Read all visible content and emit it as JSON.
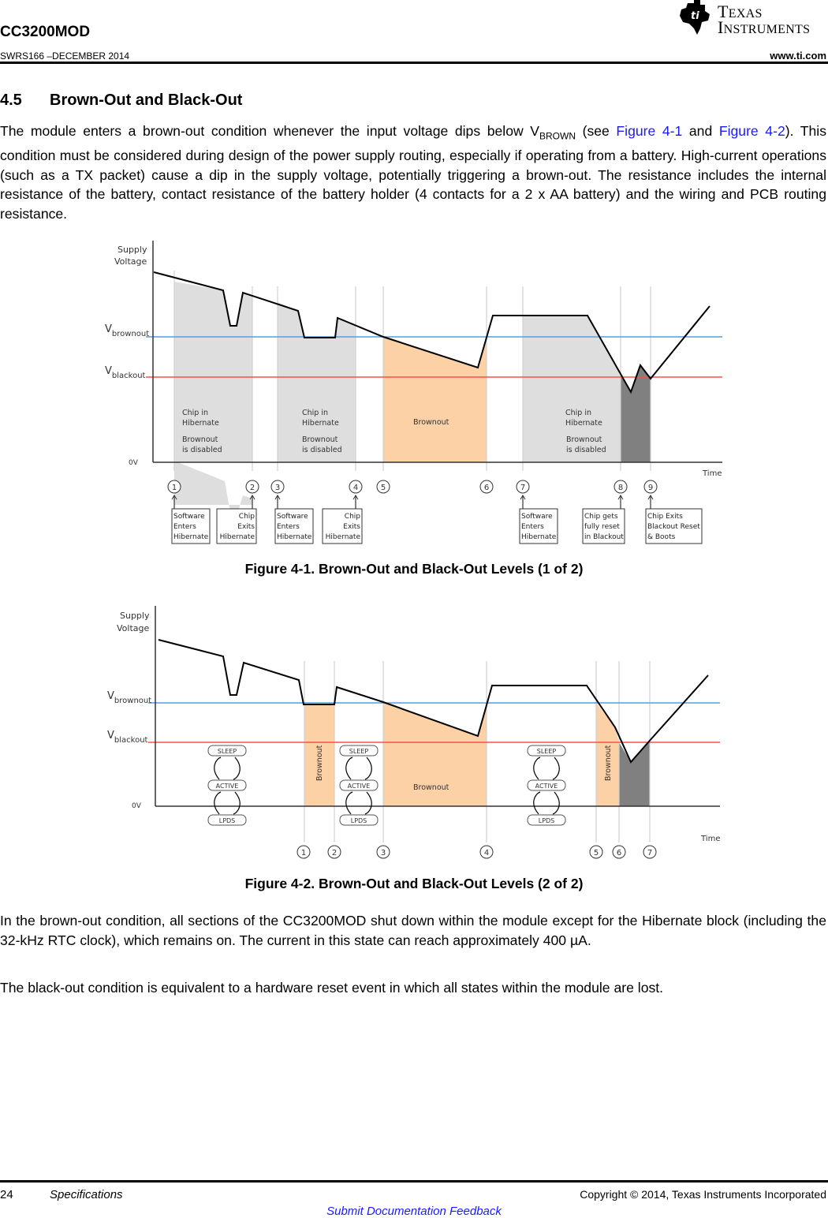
{
  "header": {
    "doc_title": "CC3200MOD",
    "doc_id": "SWRS166 –DECEMBER 2014",
    "url": "www.ti.com",
    "logo_line1": "Texas",
    "logo_line2": "Instruments"
  },
  "section": {
    "number": "4.5",
    "title": "Brown-Out and Black-Out"
  },
  "paragraph1": {
    "t1": "The module enters a brown-out condition whenever the input voltage dips below V",
    "sub": "BROWN",
    "t2": " (see ",
    "link1": "Figure 4-1",
    "t3": " and ",
    "link2": "Figure 4-2",
    "t4": "). This condition must be considered during design of the power supply routing, especially if operating from a battery. High-current operations (such as a TX packet) cause a dip in the supply voltage, potentially triggering a brown-out. The resistance includes the internal resistance of the battery, contact resistance of the battery holder (4 contacts for a 2 x AA battery) and the wiring and PCB routing resistance."
  },
  "figure1": {
    "caption": "Figure 4-1. Brown-Out and Black-Out Levels (1 of 2)",
    "y_label_1": "Supply",
    "y_label_2": "Voltage",
    "v_brownout_main": "V",
    "v_brownout_sub": "brownout",
    "v_blackout_main": "V",
    "v_blackout_sub": "blackout",
    "zero_label": "0V",
    "x_label": "Time",
    "regions": [
      {
        "line1": "Chip in",
        "line2": "Hibernate",
        "line3": "Brownout",
        "line4": "is disabled"
      },
      {
        "line1": "Chip in",
        "line2": "Hibernate",
        "line3": "Brownout",
        "line4": "is disabled"
      },
      {
        "line1": "Brownout"
      },
      {
        "line1": "Chip in",
        "line2": "Hibernate",
        "line3": "Brownout",
        "line4": "is disabled"
      }
    ],
    "markers": [
      "1",
      "2",
      "3",
      "4",
      "5",
      "6",
      "7",
      "8",
      "9"
    ],
    "events": [
      {
        "marker": "1",
        "lines": [
          "Software",
          "Enters",
          "Hibernate"
        ]
      },
      {
        "marker": "2",
        "lines": [
          "Chip",
          "Exits",
          "Hibernate"
        ]
      },
      {
        "marker": "3",
        "lines": [
          "Software",
          "Enters",
          "Hibernate"
        ]
      },
      {
        "marker": "4",
        "lines": [
          "Chip",
          "Exits",
          "Hibernate"
        ]
      },
      {
        "marker": "7",
        "lines": [
          "Software",
          "Enters",
          "Hibernate"
        ]
      },
      {
        "marker": "8",
        "lines": [
          "Chip gets",
          "fully reset",
          "in Blackout"
        ]
      },
      {
        "marker": "9",
        "lines": [
          "Chip Exits",
          "Blackout Reset",
          "& Boots"
        ]
      }
    ]
  },
  "figure2": {
    "caption": "Figure 4-2. Brown-Out and Black-Out Levels (2 of 2)",
    "y_label_1": "Supply",
    "y_label_2": "Voltage",
    "v_brownout_main": "V",
    "v_brownout_sub": "brownout",
    "v_blackout_main": "V",
    "v_blackout_sub": "blackout",
    "zero_label": "0V",
    "x_label": "Time",
    "state_labels": [
      "SLEEP",
      "ACTIVE",
      "LPDS"
    ],
    "brownout_label": "Brownout",
    "markers": [
      "1",
      "2",
      "3",
      "4",
      "5",
      "6",
      "7"
    ]
  },
  "paragraph2": "In the brown-out condition, all sections of the CC3200MOD shut down within the module except for the Hibernate block (including the 32-kHz RTC clock), which remains on. The current in this state can reach approximately 400 µA.",
  "paragraph3": "The black-out condition is equivalent to a hardware reset event in which all states within the module are lost.",
  "footer": {
    "page_number": "24",
    "section_name": "Specifications",
    "copyright": "Copyright © 2014, Texas Instruments Incorporated",
    "feedback_link": "Submit Documentation Feedback"
  },
  "colors": {
    "link": "#1a1aff",
    "brownout_line": "#5b9bd5",
    "blackout_line": "#ff4d4d",
    "hibernate_fill": "#dedede",
    "brownout_fill": "#fcd1a6",
    "blackout_fill": "#808080"
  }
}
